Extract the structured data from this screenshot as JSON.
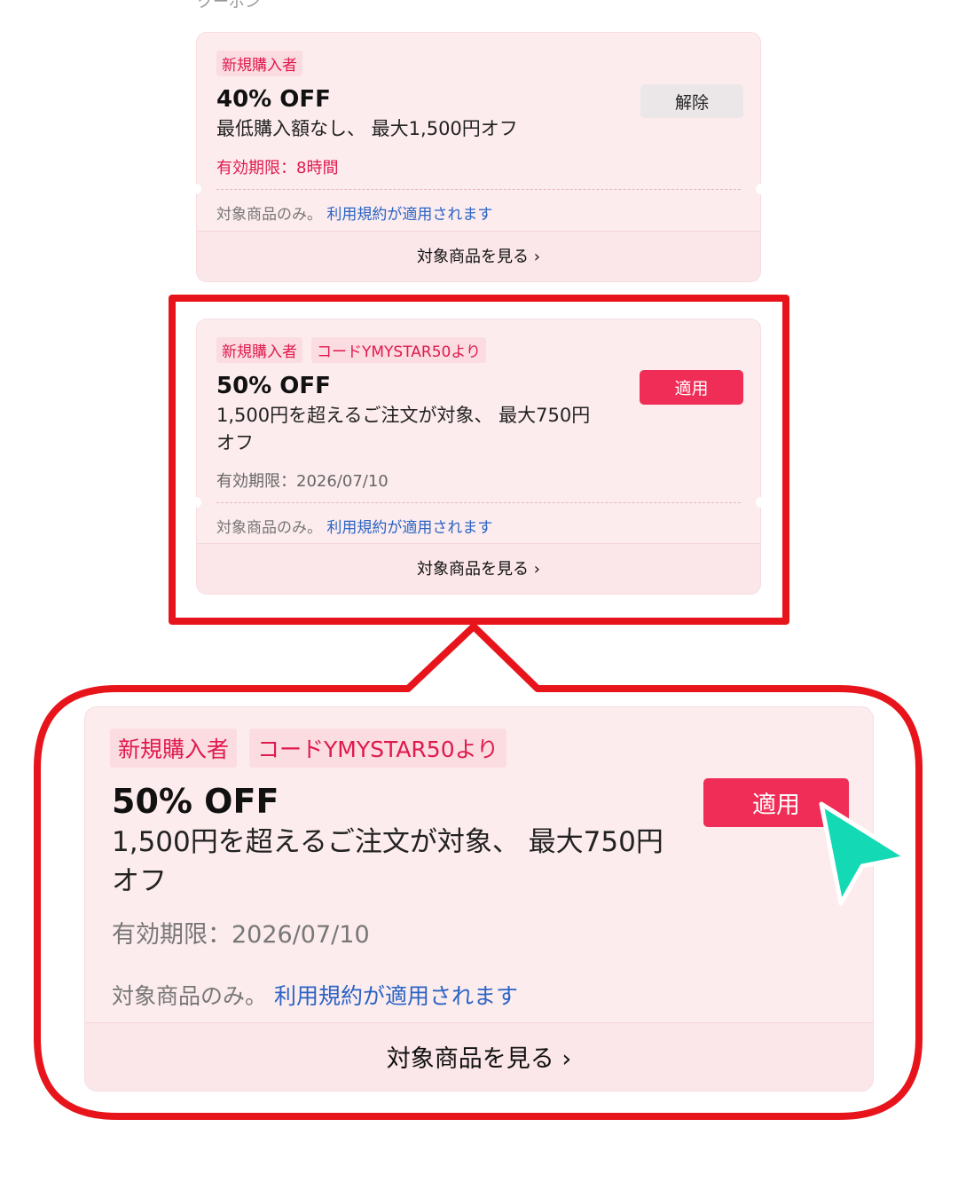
{
  "section": {
    "label": "クーポン"
  },
  "coupon1": {
    "tags": [
      "新規購入者"
    ],
    "title": "40% OFF",
    "desc_line1": "最低購入額なし、 最大1,500円オフ",
    "expiry": "有効期限：8時間",
    "terms_prefix": "対象商品のみ。",
    "terms_link": "利用規約が適用されます",
    "view_label": "対象商品を見る ›",
    "button_label": "解除"
  },
  "coupon2": {
    "tags": [
      "新規購入者",
      "コードYMYSTAR50より"
    ],
    "title": "50% OFF",
    "desc_line1": "1,500円を超えるご注文が対象、 最大750円",
    "desc_line2": "オフ",
    "expiry": "有効期限：2026/07/10",
    "terms_prefix": "対象商品のみ。",
    "terms_link": "利用規約が適用されます",
    "view_label": "対象商品を見る ›",
    "button_label": "適用"
  },
  "colors": {
    "accent": "#ef2d56",
    "tag_text": "#e0194d",
    "highlight": "#e8141b",
    "cursor": "#14d9b5",
    "link": "#2a64c4"
  },
  "icons": {
    "cursor": "cursor-arrow-icon",
    "chevron": "chevron-right-icon"
  }
}
